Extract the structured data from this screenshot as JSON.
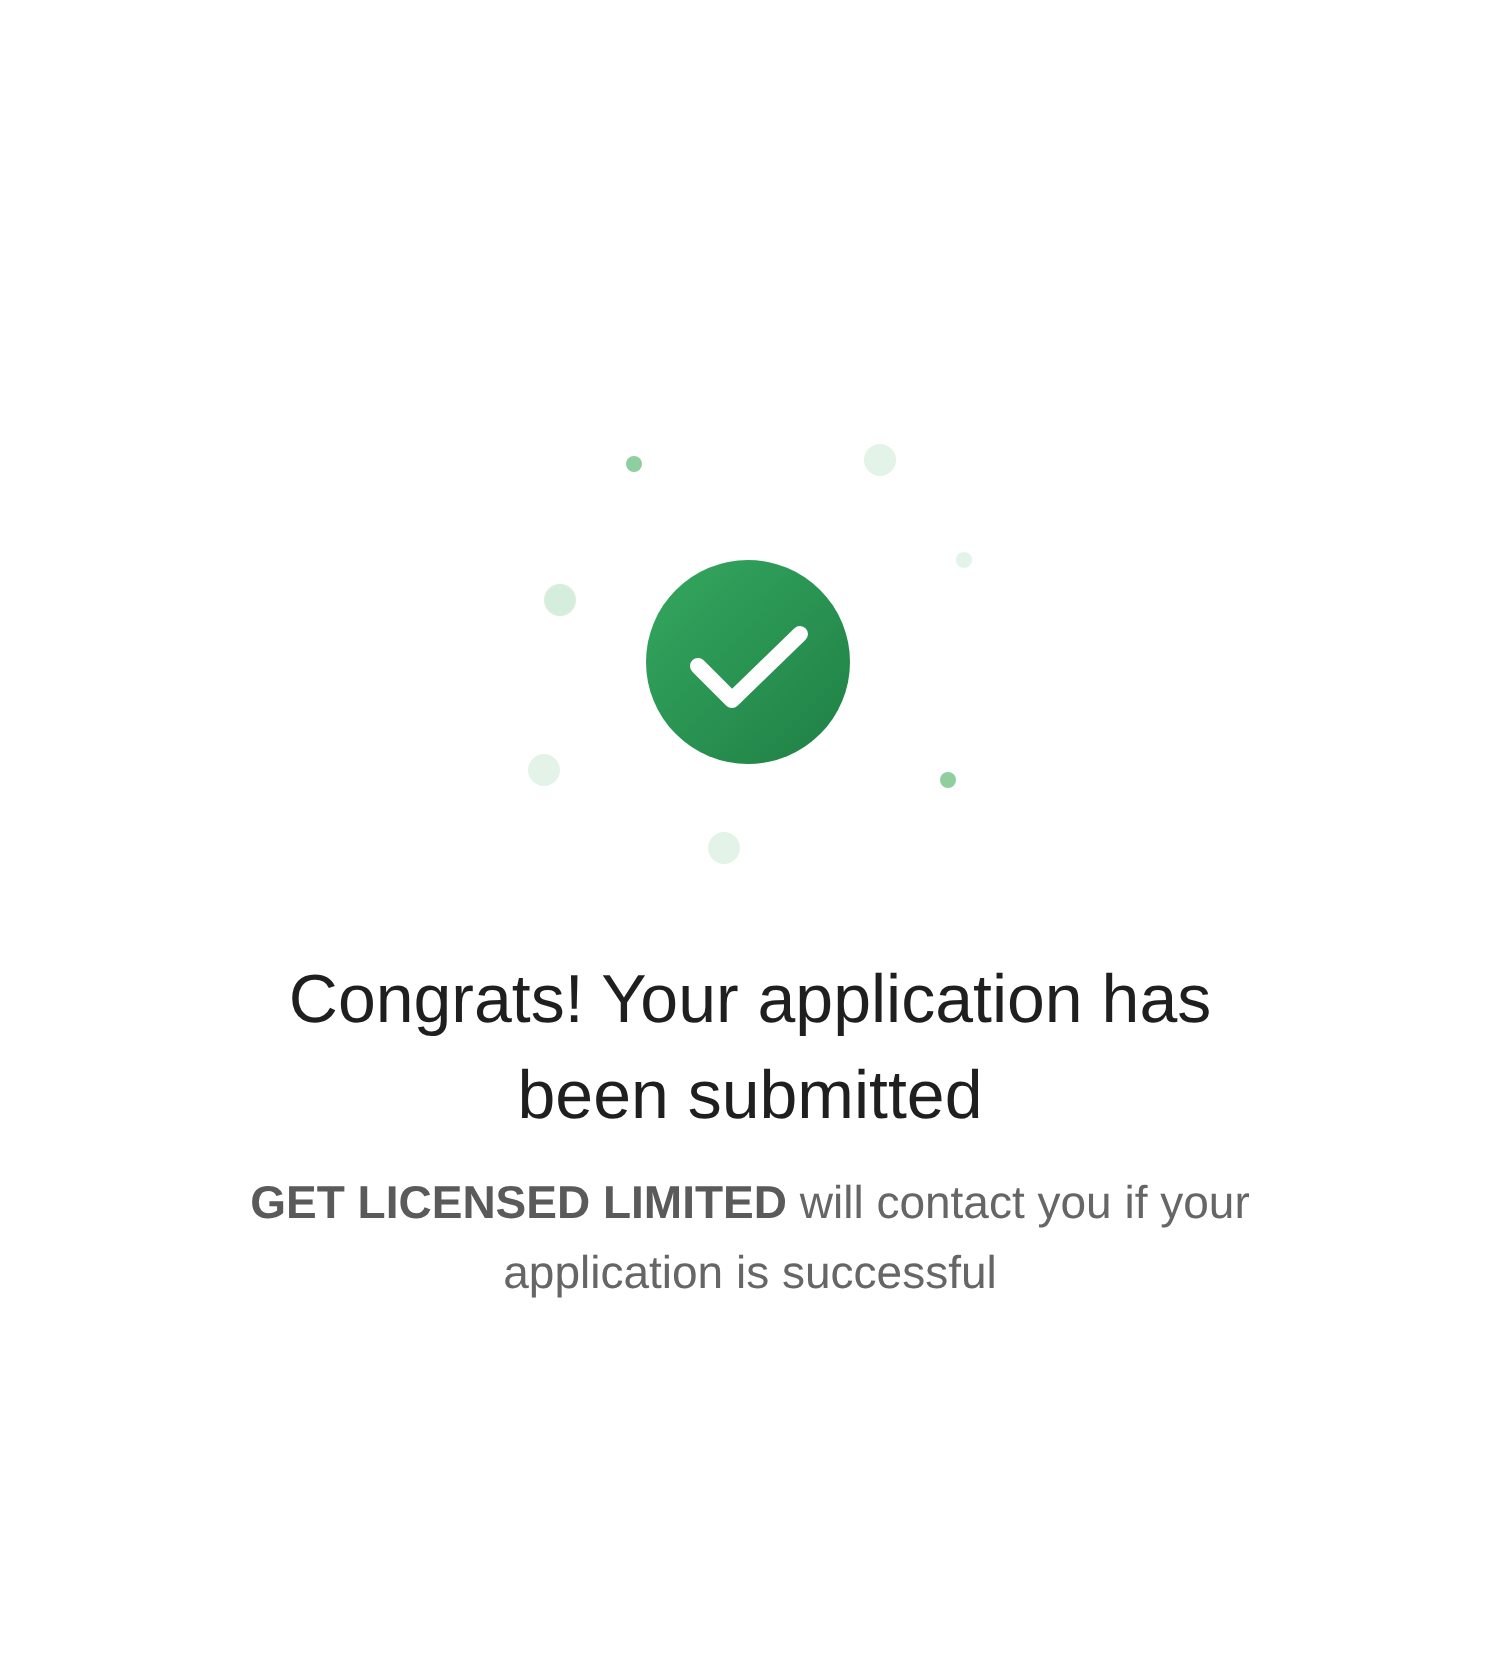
{
  "success": {
    "kind": "check"
  },
  "title": "Congrats! Your application has been submitted",
  "message": "**GET LICENSED LIMITED** will contact you if your application is successful"
}
